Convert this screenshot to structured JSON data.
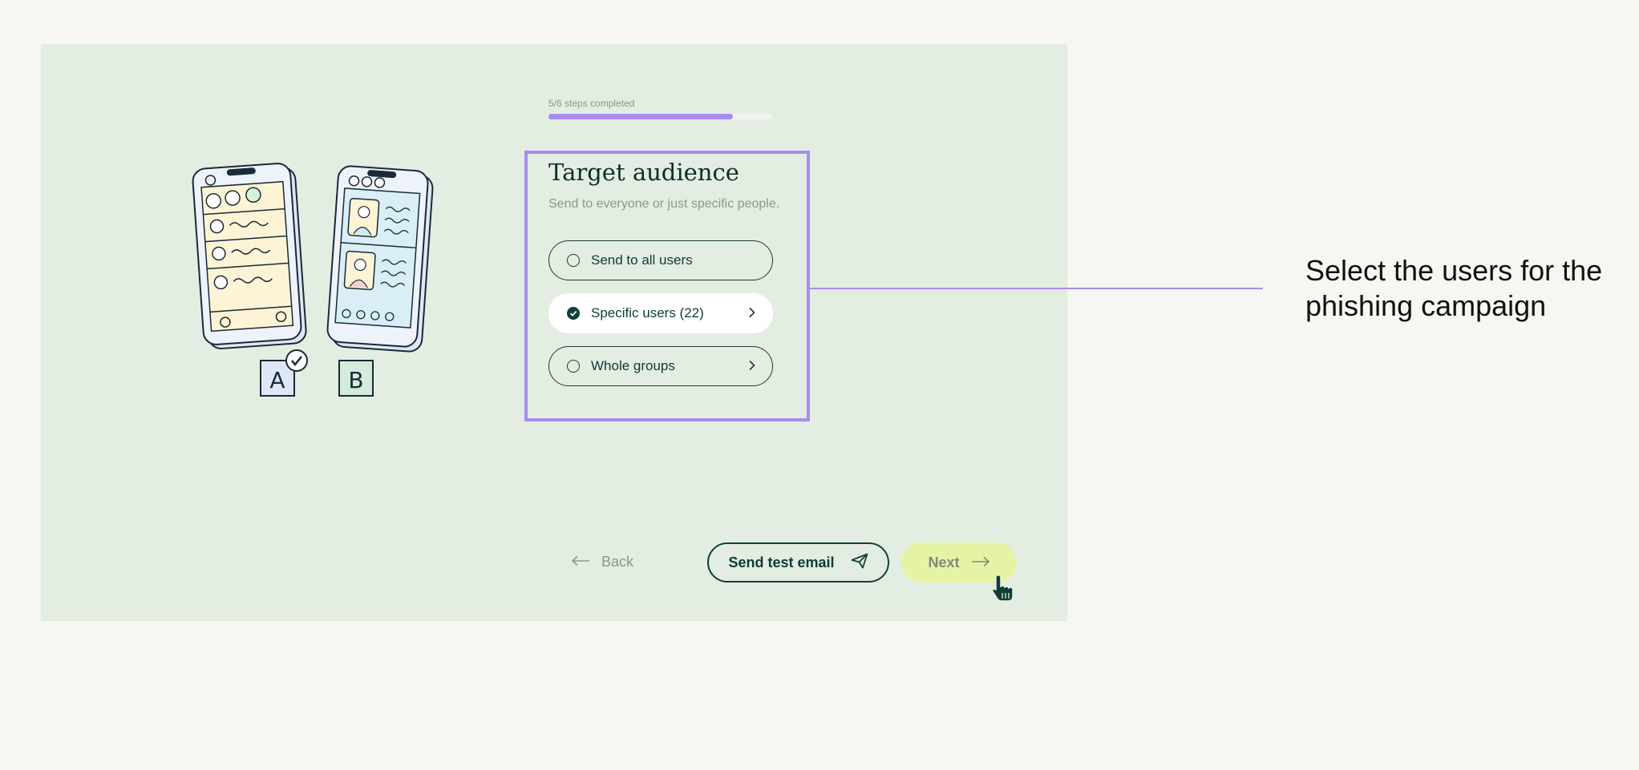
{
  "progress": {
    "label": "5/6 steps completed",
    "completed_steps": 5,
    "total_steps": 6,
    "fill_percent": 82
  },
  "card": {
    "title": "Target audience",
    "subtitle": "Send to everyone or just specific people.",
    "options": [
      {
        "label": "Send to all users",
        "selected": false,
        "has_chevron": false
      },
      {
        "label": "Specific users (22)",
        "selected": true,
        "has_chevron": true
      },
      {
        "label": "Whole groups",
        "selected": false,
        "has_chevron": true
      }
    ]
  },
  "callout": {
    "text": "Select the users for the phishing campaign"
  },
  "illustration": {
    "variant_a": "A",
    "variant_b": "B"
  },
  "footer": {
    "back_label": "Back",
    "test_email_label": "Send test email",
    "next_label": "Next"
  },
  "colors": {
    "accent": "#a98bf0",
    "primary": "#11413a",
    "panel_bg": "#e4ede2",
    "next_bg": "#e4f4a4"
  },
  "icons": {
    "back": "arrow-left-icon",
    "test_email": "paper-plane-icon",
    "next": "arrow-right-icon",
    "cursor": "hand-pointer-icon",
    "radio_checked": "check-circle-icon",
    "chevron": "chevron-right-icon"
  }
}
